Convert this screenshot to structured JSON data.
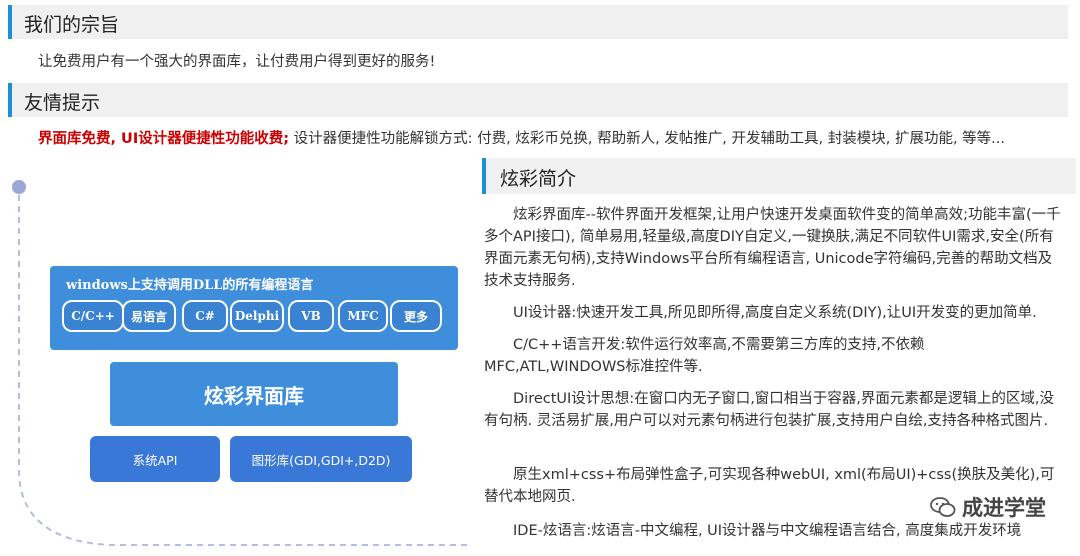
{
  "section1": {
    "title": "我们的宗旨",
    "text": "让免费用户有一个强大的界面库，让付费用户得到更好的服务!"
  },
  "section2": {
    "title": "友情提示",
    "red_text": "界面库免费, UI设计器便捷性功能收费;",
    "text": " 设计器便捷性功能解锁方式: 付费, 炫彩币兑换, 帮助新人, 发帖推广, 开发辅助工具, 封装模块, 扩展功能, 等等..."
  },
  "diagram": {
    "lang_title": "windows上支持调用DLL的所有编程语言",
    "chips": [
      "C/C++",
      "易语言",
      "C#",
      "Delphi",
      "VB",
      "MFC",
      "更多"
    ],
    "main": "炫彩界面库",
    "sys_api": "系统API",
    "graphics": "图形库(GDI,GDI+,D2D)"
  },
  "intro": {
    "title": "炫彩简介",
    "paragraphs": [
      "炫彩界面库--软件界面开发框架,让用户快速开发桌面软件变的简单高效;功能丰富(一千多个API接口), 简单易用,轻量级,高度DIY自定义,一键换肤,满足不同软件UI需求,安全(所有界面元素无句柄),支持Windows平台所有编程语言, Unicode字符编码,完善的帮助文档及技术支持服务.",
      "UI设计器:快速开发工具,所见即所得,高度自定义系统(DIY),让UI开发变的更加简单.",
      "C/C++语言开发:软件运行效率高,不需要第三方库的支持,不依赖MFC,ATL,WINDOWS标准控件等.",
      "DirectUI设计思想:在窗口内无子窗口,窗口相当于容器,界面元素都是逻辑上的区域,没有句柄. 灵活易扩展,用户可以对元素句柄进行包装扩展,支持用户自绘,支持各种格式图片.",
      "原生xml+css+布局弹性盒子,可实现各种webUI, xml(布局UI)+css(换肤及美化),可替代本地网页.",
      "IDE-炫语言:炫语言-中文编程, UI设计器与中文编程语言结合, 高度集成开发环境"
    ]
  },
  "watermark": {
    "text": "成进学堂",
    "icon": "wechat-icon"
  }
}
